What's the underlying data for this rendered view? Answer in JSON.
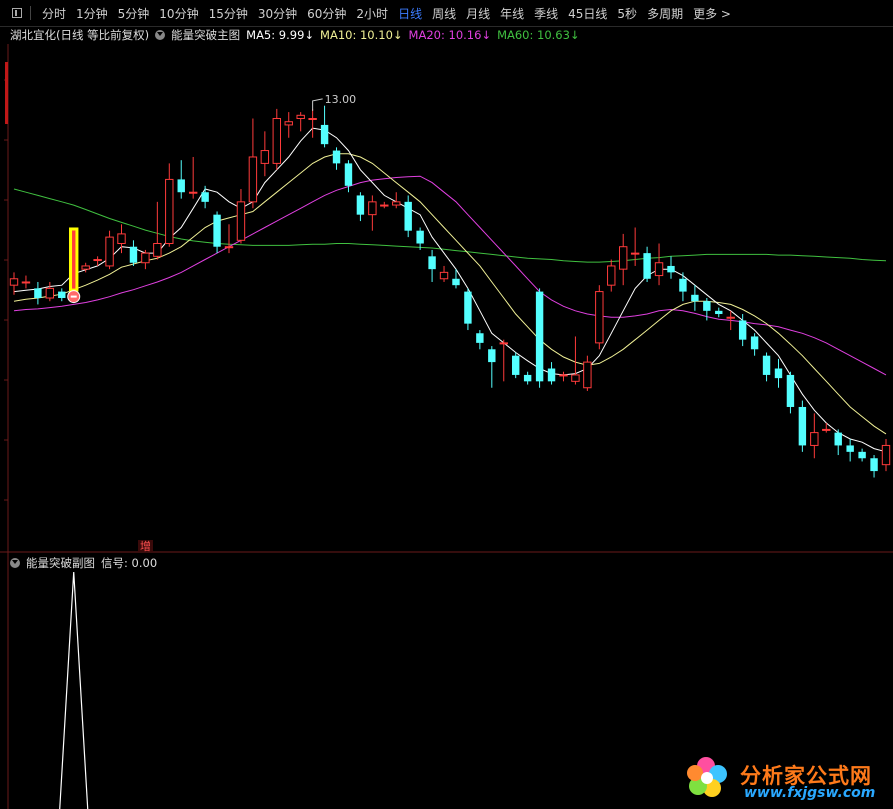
{
  "toolbar": {
    "tabs": [
      "分时",
      "1分钟",
      "5分钟",
      "10分钟",
      "15分钟",
      "30分钟",
      "60分钟",
      "2小时",
      "日线",
      "周线",
      "月线",
      "年线",
      "季线",
      "45日线",
      "5秒",
      "多周期",
      "更多 >"
    ],
    "active_tab": "日线"
  },
  "header": {
    "stock": "湖北宜化(日线 等比前复权)",
    "indicator": "能量突破主图",
    "ma5": "MA5: 9.99↓",
    "ma10": "MA10: 10.10↓",
    "ma20": "MA20: 10.16↓",
    "ma60": "MA60: 10.63↓"
  },
  "sub_header": {
    "indicator": "能量突破副图",
    "signal": "信号: 0.00"
  },
  "annotations": {
    "high_label": "13.00",
    "marker_label": "增"
  },
  "colors": {
    "up": "#ff3b3b",
    "down": "#54ffff",
    "ma5": "#ffffff",
    "ma10": "#f0f096",
    "ma20": "#e040e0",
    "ma60": "#40c040",
    "signal_bar": "#ffff00",
    "active_tab": "#3c7cff"
  },
  "watermark": {
    "text": "分析家公式网",
    "url": "www.fxjgsw.com"
  },
  "chart_data": [
    {
      "type": "candlestick",
      "title": "湖北宜化(日线 等比前复权)",
      "ylim": [
        6.0,
        13.8
      ],
      "candles": [
        [
          10.1,
          10.2,
          9.95,
          10.3
        ],
        [
          10.15,
          10.15,
          10.05,
          10.25
        ],
        [
          10.05,
          9.9,
          9.8,
          10.15
        ],
        [
          9.9,
          10.05,
          9.85,
          10.15
        ],
        [
          10.0,
          9.9,
          9.85,
          10.05
        ],
        [
          10.05,
          10.95,
          10.0,
          11.0
        ],
        [
          10.35,
          10.4,
          10.3,
          10.45
        ],
        [
          10.5,
          10.5,
          10.4,
          10.55
        ],
        [
          10.4,
          10.85,
          10.35,
          10.95
        ],
        [
          10.75,
          10.9,
          10.6,
          11.05
        ],
        [
          10.7,
          10.45,
          10.4,
          10.8
        ],
        [
          10.45,
          10.6,
          10.35,
          10.65
        ],
        [
          10.55,
          10.75,
          10.5,
          11.4
        ],
        [
          10.75,
          11.75,
          10.7,
          12.0
        ],
        [
          11.75,
          11.55,
          11.45,
          12.05
        ],
        [
          11.55,
          11.55,
          11.45,
          12.1
        ],
        [
          11.55,
          11.4,
          11.3,
          11.65
        ],
        [
          11.2,
          10.7,
          10.6,
          11.25
        ],
        [
          10.7,
          10.7,
          10.6,
          11.05
        ],
        [
          10.8,
          11.4,
          10.75,
          11.6
        ],
        [
          11.4,
          12.1,
          11.3,
          12.7
        ],
        [
          12.0,
          12.2,
          11.8,
          12.5
        ],
        [
          12.0,
          12.7,
          11.9,
          12.85
        ],
        [
          12.6,
          12.65,
          12.4,
          12.8
        ],
        [
          12.7,
          12.75,
          12.5,
          12.8
        ],
        [
          12.7,
          12.7,
          12.4,
          12.85
        ],
        [
          12.6,
          12.3,
          12.25,
          12.9
        ],
        [
          12.2,
          12.0,
          11.9,
          12.25
        ],
        [
          12.0,
          11.65,
          11.55,
          12.05
        ],
        [
          11.5,
          11.2,
          11.1,
          11.55
        ],
        [
          11.2,
          11.4,
          10.95,
          11.5
        ],
        [
          11.35,
          11.35,
          11.3,
          11.4
        ],
        [
          11.35,
          11.4,
          11.3,
          11.55
        ],
        [
          11.4,
          10.95,
          10.85,
          11.5
        ],
        [
          10.95,
          10.75,
          10.65,
          11.0
        ],
        [
          10.55,
          10.35,
          10.15,
          10.65
        ],
        [
          10.2,
          10.3,
          10.15,
          10.4
        ],
        [
          10.2,
          10.1,
          10.05,
          10.35
        ],
        [
          10.0,
          9.5,
          9.4,
          10.05
        ],
        [
          9.35,
          9.2,
          9.1,
          9.4
        ],
        [
          9.1,
          8.9,
          8.5,
          9.15
        ],
        [
          9.2,
          9.2,
          8.6,
          9.25
        ],
        [
          9.0,
          8.7,
          8.65,
          9.05
        ],
        [
          8.7,
          8.6,
          8.55,
          8.75
        ],
        [
          10.0,
          8.6,
          8.5,
          10.05
        ],
        [
          8.8,
          8.6,
          8.55,
          8.9
        ],
        [
          8.7,
          8.7,
          8.6,
          8.75
        ],
        [
          8.6,
          8.7,
          8.55,
          9.3
        ],
        [
          8.5,
          8.9,
          8.45,
          9.0
        ],
        [
          9.2,
          10.0,
          9.1,
          10.1
        ],
        [
          10.1,
          10.4,
          10.0,
          10.5
        ],
        [
          10.35,
          10.7,
          10.1,
          10.9
        ],
        [
          10.6,
          10.6,
          10.4,
          11.0
        ],
        [
          10.6,
          10.2,
          10.15,
          10.7
        ],
        [
          10.25,
          10.45,
          10.1,
          10.75
        ],
        [
          10.4,
          10.3,
          10.2,
          10.55
        ],
        [
          10.2,
          10.0,
          9.85,
          10.3
        ],
        [
          9.95,
          9.85,
          9.7,
          10.1
        ],
        [
          9.85,
          9.7,
          9.55,
          9.9
        ],
        [
          9.7,
          9.65,
          9.6,
          9.75
        ],
        [
          9.6,
          9.6,
          9.4,
          9.7
        ],
        [
          9.55,
          9.25,
          9.15,
          9.65
        ],
        [
          9.3,
          9.1,
          9.0,
          9.35
        ],
        [
          9.0,
          8.7,
          8.6,
          9.05
        ],
        [
          8.8,
          8.65,
          8.5,
          8.95
        ],
        [
          8.7,
          8.2,
          8.1,
          8.75
        ],
        [
          8.2,
          7.6,
          7.5,
          8.3
        ],
        [
          7.6,
          7.8,
          7.4,
          8.1
        ],
        [
          7.85,
          7.85,
          7.8,
          7.95
        ],
        [
          7.8,
          7.6,
          7.45,
          7.85
        ],
        [
          7.6,
          7.5,
          7.35,
          7.7
        ],
        [
          7.5,
          7.4,
          7.35,
          7.55
        ],
        [
          7.4,
          7.2,
          7.1,
          7.45
        ],
        [
          7.3,
          7.6,
          7.2,
          7.7
        ]
      ],
      "ma5": [
        10.0,
        10.02,
        10.04,
        10.08,
        10.1,
        10.28,
        10.34,
        10.4,
        10.52,
        10.7,
        10.68,
        10.6,
        10.6,
        10.83,
        11.0,
        11.3,
        11.6,
        11.55,
        11.4,
        11.3,
        11.4,
        11.7,
        11.9,
        12.1,
        12.35,
        12.55,
        12.52,
        12.4,
        12.2,
        11.9,
        11.7,
        11.5,
        11.4,
        11.3,
        11.2,
        10.85,
        10.6,
        10.35,
        10.05,
        9.7,
        9.35,
        9.2,
        9.05,
        8.92,
        8.8,
        8.72,
        8.7,
        8.72,
        8.8,
        9.0,
        9.35,
        9.7,
        10.05,
        10.25,
        10.35,
        10.35,
        10.25,
        10.1,
        9.95,
        9.8,
        9.7,
        9.55,
        9.4,
        9.2,
        9.0,
        8.7,
        8.4,
        8.15,
        7.95,
        7.8,
        7.7,
        7.65,
        7.55,
        7.5
      ],
      "ma10": [
        9.85,
        9.88,
        9.9,
        9.93,
        9.96,
        10.03,
        10.1,
        10.18,
        10.27,
        10.38,
        10.43,
        10.48,
        10.52,
        10.6,
        10.7,
        10.85,
        11.0,
        11.1,
        11.15,
        11.2,
        11.25,
        11.4,
        11.55,
        11.7,
        11.85,
        12.0,
        12.1,
        12.15,
        12.15,
        12.1,
        12.0,
        11.85,
        11.7,
        11.55,
        11.4,
        11.2,
        11.0,
        10.8,
        10.6,
        10.4,
        10.15,
        9.9,
        9.65,
        9.45,
        9.25,
        9.1,
        8.98,
        8.9,
        8.85,
        8.88,
        8.98,
        9.1,
        9.25,
        9.4,
        9.55,
        9.7,
        9.8,
        9.85,
        9.85,
        9.83,
        9.8,
        9.72,
        9.62,
        9.5,
        9.35,
        9.18,
        9.0,
        8.8,
        8.6,
        8.4,
        8.2,
        8.05,
        7.9,
        7.78
      ],
      "ma20": [
        9.7,
        9.72,
        9.73,
        9.75,
        9.77,
        9.8,
        9.83,
        9.87,
        9.92,
        9.98,
        10.03,
        10.09,
        10.15,
        10.22,
        10.3,
        10.4,
        10.5,
        10.6,
        10.7,
        10.8,
        10.9,
        11.0,
        11.1,
        11.2,
        11.3,
        11.4,
        11.5,
        11.58,
        11.64,
        11.7,
        11.74,
        11.76,
        11.78,
        11.79,
        11.8,
        11.7,
        11.55,
        11.4,
        11.2,
        11.0,
        10.8,
        10.6,
        10.4,
        10.2,
        10.0,
        9.87,
        9.77,
        9.7,
        9.65,
        9.62,
        9.6,
        9.6,
        9.62,
        9.65,
        9.7,
        9.72,
        9.7,
        9.66,
        9.61,
        9.57,
        9.55,
        9.53,
        9.5,
        9.48,
        9.45,
        9.4,
        9.35,
        9.28,
        9.2,
        9.1,
        9.0,
        8.9,
        8.8,
        8.7
      ],
      "ma60": [
        11.6,
        11.55,
        11.5,
        11.45,
        11.4,
        11.35,
        11.28,
        11.21,
        11.14,
        11.08,
        11.02,
        10.96,
        10.91,
        10.86,
        10.82,
        10.79,
        10.77,
        10.75,
        10.74,
        10.73,
        10.72,
        10.72,
        10.72,
        10.72,
        10.73,
        10.74,
        10.74,
        10.75,
        10.75,
        10.74,
        10.73,
        10.72,
        10.71,
        10.7,
        10.69,
        10.68,
        10.66,
        10.64,
        10.62,
        10.6,
        10.58,
        10.56,
        10.54,
        10.52,
        10.51,
        10.5,
        10.48,
        10.47,
        10.46,
        10.46,
        10.47,
        10.48,
        10.5,
        10.52,
        10.53,
        10.55,
        10.56,
        10.57,
        10.58,
        10.58,
        10.58,
        10.58,
        10.58,
        10.58,
        10.57,
        10.57,
        10.56,
        10.55,
        10.54,
        10.53,
        10.52,
        10.5,
        10.49,
        10.48
      ],
      "signal_bar_index": 5,
      "high_label_index": 25
    },
    {
      "type": "line",
      "title": "能量突破副图",
      "ylim": [
        0,
        1
      ],
      "signal": [
        1,
        0
      ]
    }
  ]
}
